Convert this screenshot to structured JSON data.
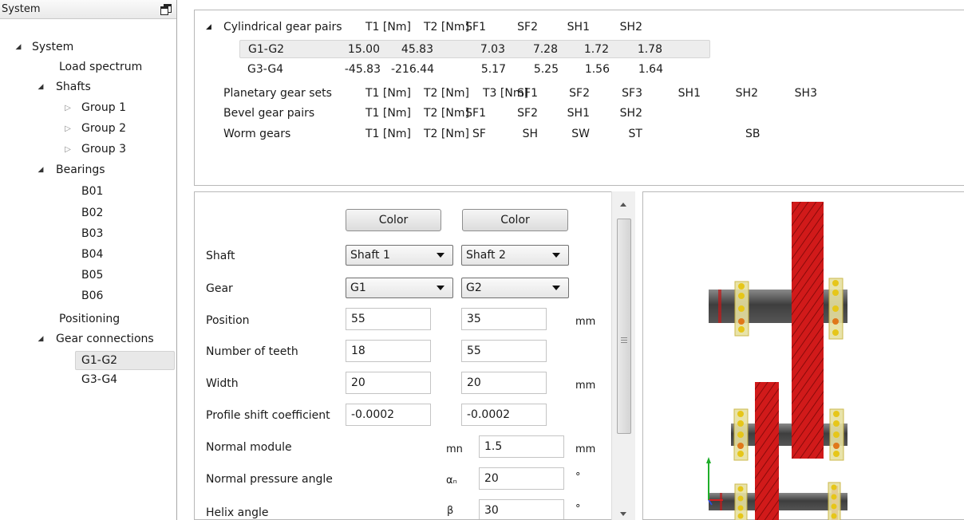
{
  "sidebar": {
    "title": "System",
    "tree": [
      {
        "label": "System",
        "caret": "open"
      },
      {
        "label": "Load spectrum",
        "caret": "none"
      },
      {
        "label": "Shafts",
        "caret": "open"
      },
      {
        "label": "Group 1",
        "caret": "closed"
      },
      {
        "label": "Group 2",
        "caret": "closed"
      },
      {
        "label": "Group 3",
        "caret": "closed"
      },
      {
        "label": "Bearings",
        "caret": "open"
      },
      {
        "label": "B01",
        "caret": "none"
      },
      {
        "label": "B02",
        "caret": "none"
      },
      {
        "label": "B03",
        "caret": "none"
      },
      {
        "label": "B04",
        "caret": "none"
      },
      {
        "label": "B05",
        "caret": "none"
      },
      {
        "label": "B06",
        "caret": "none"
      },
      {
        "label": "Positioning",
        "caret": "none"
      },
      {
        "label": "Gear connections",
        "caret": "open"
      },
      {
        "label": "G1-G2",
        "caret": "none",
        "selected": true
      },
      {
        "label": "G3-G4",
        "caret": "none"
      }
    ]
  },
  "results": {
    "cylindrical": {
      "title": "Cylindrical gear pairs",
      "headers": [
        "T1 [Nm]",
        "T2 [Nm]",
        "SF1",
        "SF2",
        "SH1",
        "SH2"
      ],
      "rows": [
        {
          "name": "G1-G2",
          "values": [
            "15.00",
            "45.83",
            "7.03",
            "7.28",
            "1.72",
            "1.78"
          ]
        },
        {
          "name": "G3-G4",
          "values": [
            "-45.83",
            "-216.44",
            "5.17",
            "5.25",
            "1.56",
            "1.64"
          ]
        }
      ]
    },
    "planetary": {
      "title": "Planetary gear sets",
      "headers": [
        "T1 [Nm]",
        "T2 [Nm]",
        "T3 [Nm]",
        "SF1",
        "SF2",
        "SF3",
        "SH1",
        "SH2",
        "SH3"
      ]
    },
    "bevel": {
      "title": "Bevel gear pairs",
      "headers": [
        "T1 [Nm]",
        "T2 [Nm]",
        "SF1",
        "SF2",
        "SH1",
        "SH2"
      ]
    },
    "worm": {
      "title": "Worm gears",
      "headers": [
        "T1 [Nm]",
        "T2 [Nm]",
        "SF",
        "SH",
        "SW",
        "ST",
        "SB"
      ]
    }
  },
  "properties": {
    "color_button_1": "Color",
    "color_button_2": "Color",
    "shaft": {
      "label": "Shaft",
      "value1": "Shaft 1",
      "value2": "Shaft 2"
    },
    "gear": {
      "label": "Gear",
      "value1": "G1",
      "value2": "G2"
    },
    "position": {
      "label": "Position",
      "value1": "55",
      "value2": "35",
      "unit": "mm"
    },
    "teeth": {
      "label": "Number of teeth",
      "value1": "18",
      "value2": "55"
    },
    "width": {
      "label": "Width",
      "value1": "20",
      "value2": "20",
      "unit": "mm"
    },
    "profile_shift": {
      "label": "Profile shift coefficient",
      "value1": "-0.0002",
      "value2": "-0.0002"
    },
    "normal_module": {
      "label": "Normal module",
      "symbol": "mn",
      "value": "1.5",
      "unit": "mm"
    },
    "pressure_angle": {
      "label": "Normal pressure angle",
      "symbol": "αₙ",
      "value": "20",
      "unit": "°"
    },
    "helix_angle": {
      "label": "Helix angle",
      "symbol": "β",
      "value": "30",
      "unit": "°"
    }
  },
  "colors": {
    "gear": "#d11a1a",
    "shaft": "#555555",
    "bearing": "#e6c619",
    "axis_x": "#d42020",
    "axis_y": "#1fae2a",
    "axis_z": "#2d4ed8"
  }
}
